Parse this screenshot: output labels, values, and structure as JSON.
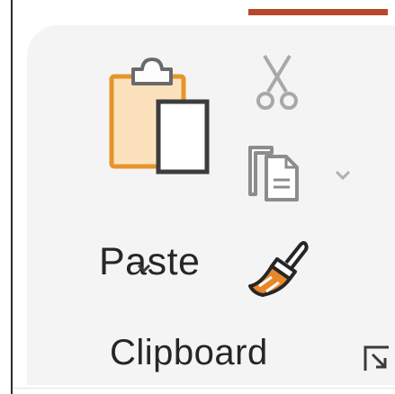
{
  "ribbon": {
    "accent_color": "#b7472a",
    "panel_color": "#f4f4f4",
    "clipboard_group": {
      "label": "Clipboard",
      "paste": {
        "label": "Paste",
        "icon": "clipboard-paste-icon",
        "dropdown_icon": "chevron-down-icon"
      },
      "cut": {
        "icon": "scissors-icon",
        "state": "disabled"
      },
      "copy": {
        "icon": "copy-icon",
        "dropdown_icon": "chevron-down-icon"
      },
      "format_painter": {
        "icon": "paintbrush-icon",
        "brush_color": "#e8872a"
      },
      "launcher_icon": "dialog-launcher-icon"
    }
  }
}
